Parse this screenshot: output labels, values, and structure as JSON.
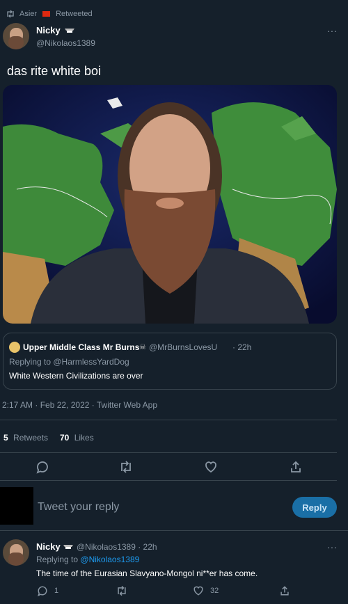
{
  "retweet_bar": {
    "user": "Asier",
    "label": "Retweeted"
  },
  "tweet": {
    "author_name": "Nicky",
    "author_handle": "@Nikolaos1389",
    "text": "das rite white boi",
    "more_label": "···"
  },
  "quote": {
    "author_name": "Upper Middle Class Mr Burns",
    "author_handle": "@MrBurnsLovesU",
    "time": "· 22h",
    "replying_to": "Replying to @HarmlessYardDog",
    "text": "White Western Civilizations are over"
  },
  "meta": {
    "timestamp": "2:17 AM · Feb 22, 2022 · Twitter Web App"
  },
  "stats": {
    "retweets_count": "5",
    "retweets_label": "Retweets",
    "likes_count": "70",
    "likes_label": "Likes"
  },
  "reply_box": {
    "placeholder": "Tweet your reply",
    "button_label": "Reply"
  },
  "reply": {
    "author_name": "Nicky",
    "author_handle": "@Nikolaos1389 · 22h",
    "replying_prefix": "Replying to",
    "replying_handle": "@Nikolaos1389",
    "text": "The time of the Eurasian Slavyano-Mongol ni**er has come.",
    "reply_count": "1",
    "like_count": "32"
  },
  "colors": {
    "background": "#15202b",
    "accent": "#1d9bf0",
    "muted": "#8b98a5"
  }
}
